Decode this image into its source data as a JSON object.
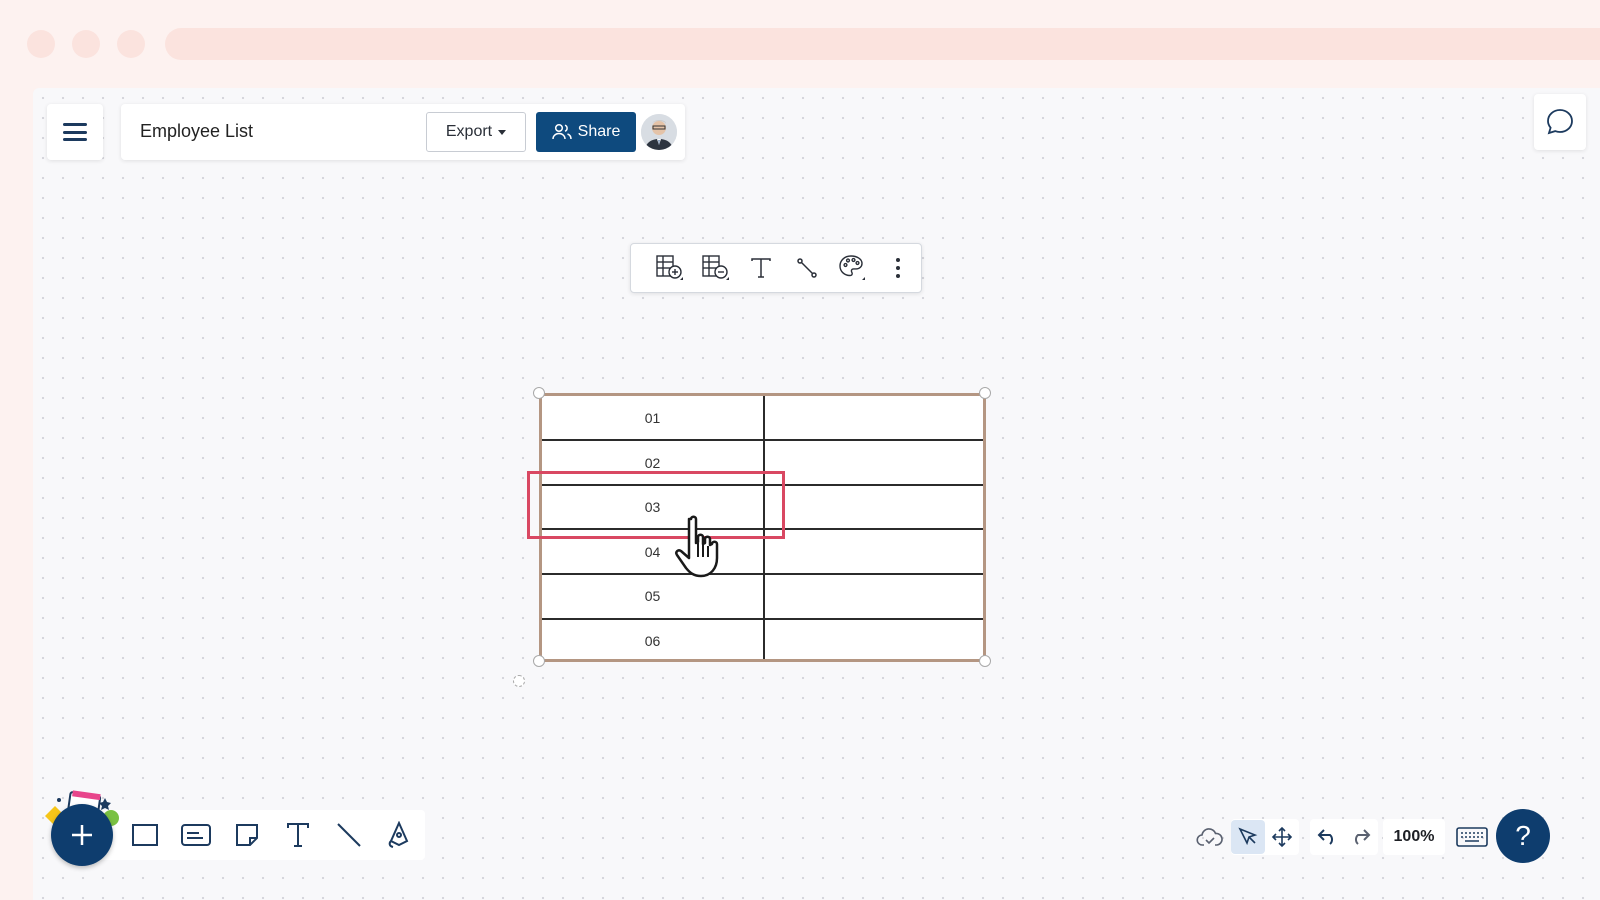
{
  "header": {
    "doc_title": "Employee List",
    "export_label": "Export",
    "share_label": "Share"
  },
  "table": {
    "rows": [
      {
        "label": "01",
        "value": ""
      },
      {
        "label": "02",
        "value": ""
      },
      {
        "label": "03",
        "value": ""
      },
      {
        "label": "04",
        "value": ""
      },
      {
        "label": "05",
        "value": ""
      },
      {
        "label": "06",
        "value": ""
      }
    ],
    "border_color": "#b49682",
    "selected_row": "03",
    "selection_color": "#d94862"
  },
  "context_toolbar": {
    "items": [
      "add-row-icon",
      "remove-row-icon",
      "text-icon",
      "connector-icon",
      "palette-icon",
      "more-icon"
    ]
  },
  "bottom_toolbar": {
    "items": [
      "rectangle-icon",
      "card-icon",
      "sticky-note-icon",
      "text-icon",
      "line-icon",
      "pen-icon"
    ]
  },
  "view_controls": {
    "zoom": "100%"
  },
  "colors": {
    "primary": "#0e4a7e",
    "canvas_bg": "#f8f8fa",
    "frame_bg": "#fdf2f0"
  }
}
